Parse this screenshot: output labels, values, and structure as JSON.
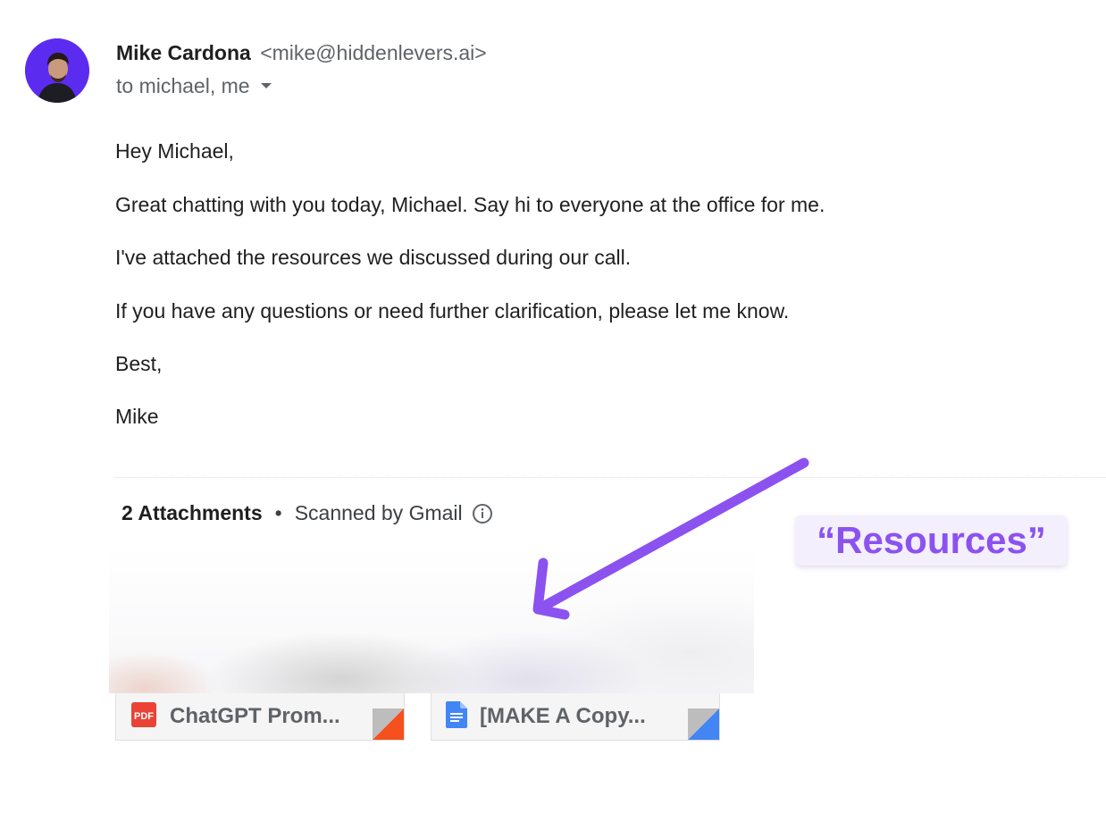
{
  "sender": {
    "name": "Mike Cardona",
    "email": "<mike@hiddenlevers.ai>",
    "recipients": "to michael, me"
  },
  "message": {
    "greeting": "Hey Michael,",
    "lines": [
      "Great chatting with you today, Michael. Say hi to everyone at the office for me.",
      "I've attached the resources we discussed during our call.",
      "If you have any questions or need further clarification, please let me know.",
      "Best,",
      "Mike"
    ]
  },
  "attachments": {
    "count_label": "2 Attachments",
    "separator": "•",
    "scanned_label": "Scanned by Gmail",
    "items": [
      {
        "name": "ChatGPT Prom...",
        "icon": "pdf-icon",
        "icon_text": "PDF",
        "accent": "#f4511e"
      },
      {
        "name": "[MAKE A Copy...",
        "icon": "google-docs-icon",
        "accent": "#4285f4"
      }
    ]
  },
  "annotation": {
    "label": "“Resources”",
    "color": "#8b52f0"
  },
  "colors": {
    "avatar_bg": "#5b2cf0",
    "pdf_red": "#ea4335",
    "docs_blue": "#4285f4"
  }
}
